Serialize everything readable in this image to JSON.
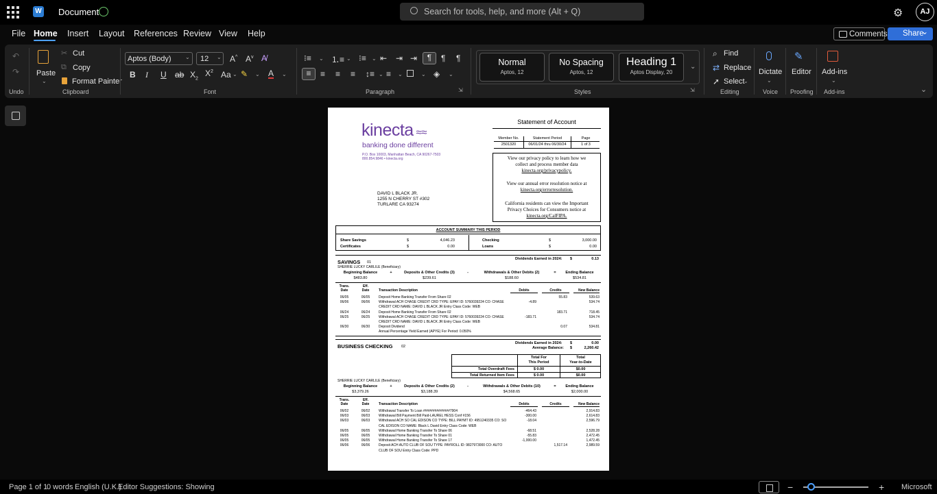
{
  "titlebar": {
    "title": "Document",
    "search_placeholder": "Search for tools, help, and more (Alt + Q)",
    "avatar": "AJ"
  },
  "menu": {
    "items": [
      "File",
      "Home",
      "Insert",
      "Layout",
      "References",
      "Review",
      "View",
      "Help"
    ],
    "comments": "Comments",
    "share": "Share"
  },
  "ribbon": {
    "clipboard": {
      "paste": "Paste",
      "cut": "Cut",
      "copy": "Copy",
      "format_painter": "Format Painter",
      "group": "Clipboard"
    },
    "undo_group": "Undo",
    "font": {
      "name": "Aptos (Body)",
      "size": "12",
      "group": "Font"
    },
    "paragraph": {
      "group": "Paragraph"
    },
    "styles": {
      "group": "Styles",
      "items": [
        {
          "name": "Normal",
          "sub": "Aptos, 12"
        },
        {
          "name": "No Spacing",
          "sub": "Aptos, 12"
        },
        {
          "name": "Heading 1",
          "sub": "Aptos Display, 20"
        }
      ]
    },
    "editing": {
      "find": "Find",
      "replace": "Replace",
      "select": "Select",
      "group": "Editing"
    },
    "voice": {
      "dictate": "Dictate",
      "group": "Voice"
    },
    "proofing": {
      "editor": "Editor",
      "group": "Proofing"
    },
    "addins": {
      "label": "Add-ins",
      "group": "Add-ins"
    }
  },
  "statusbar": {
    "page": "Page 1 of 1",
    "words": "0 words",
    "language": "English (U.K.)",
    "suggestions": "Editor Suggestions: Showing",
    "zoom_label": "Microsoft"
  },
  "doc": {
    "brand": "kinecta",
    "tagline": "banking done different",
    "address1": "P.O. Box 10003, Manhattan Beach, CA 90267-7503",
    "address2": "800.854.9846 • kinecta.org",
    "statement_title": "Statement of Account",
    "hdr": {
      "member_label": "Member No.",
      "period_label": "Statement Period",
      "page_label": "Page",
      "member": "2501320",
      "period": "06/01/24 thru 06/30/24",
      "page": "1 of 3"
    },
    "notice": [
      "View our privacy policy to learn how we",
      "collect and process member data",
      "kinecta.org/privacypolicy.",
      "View our annual error resolution notice at",
      "kinecta.org/errorresolution.",
      "California residents can view the Important",
      "Privacy Choices for Consumers notice at",
      "kinecta.org/CalFIPA."
    ],
    "recipient": [
      "DAVID L BLACK JR.",
      "1255 N CHERRY ST #302",
      "TURLARE CA 93274"
    ],
    "summary": {
      "title": "ACCOUNT SUMMARY THIS PERIOD",
      "share_savings": "Share Savings",
      "certificates": "Certificates",
      "checking": "Checking",
      "loans": "Loans",
      "dollar": "$",
      "v_ss": "4,046.23",
      "v_cert": "0.00",
      "v_chk": "3,000.00",
      "v_loans": "0.00"
    },
    "savings": {
      "title": "SAVINGS",
      "code": "01",
      "div_label": "Dividends Earned in 2024:",
      "div_val": "0.13",
      "dollar": "$",
      "beneficiary": "SHERRIE LUCKY CARLILE (Beneficiary)",
      "bal_labels": [
        "Beginning Balance",
        "+",
        "Deposits & Other Credits (3)",
        "-",
        "Withdrawals & Other Debits (2)",
        "=",
        "Ending Balance"
      ],
      "bal_values": [
        "$483.80",
        "$239.61",
        "$188.60",
        "$534.81"
      ],
      "cols": [
        "Trans.",
        "Date",
        "Eff.",
        "Date",
        "Transaction Description",
        "Debits",
        "Credits",
        "New Balance"
      ],
      "rows": [
        {
          "t": "06/05",
          "e": "06/05",
          "d": "Deposit Home Banking Transfer From Share 02",
          "db": "",
          "cr": "55.83",
          "nb": "539.63"
        },
        {
          "t": "06/06",
          "e": "06/06",
          "d": "Withdrawal ACH CHASE CREDIT CRD TYPE: EPAY ID: 5760039224 CO: CHASE",
          "db": "-4.89",
          "cr": "",
          "nb": "534.74"
        },
        {
          "t": "",
          "e": "",
          "d": "CREDIT CRD NAME: DAVID L BLACK JR Entry Class Code: WEB",
          "db": "",
          "cr": "",
          "nb": ""
        },
        {
          "t": "06/24",
          "e": "06/24",
          "d": "Deposit Home Banking Transfer From Share 02",
          "db": "",
          "cr": "183.71",
          "nb": "718.45"
        },
        {
          "t": "06/25",
          "e": "06/25",
          "d": "Withdrawal ACH CHASE CREDIT CRD TYPE: EPAY ID: 5760039224 CO: CHASE",
          "db": "-183.71",
          "cr": "",
          "nb": "534.74"
        },
        {
          "t": "",
          "e": "",
          "d": "CREDIT CRD NAME: DAVID L BLACK JR Entry Class Code: WEB",
          "db": "",
          "cr": "",
          "nb": ""
        },
        {
          "t": "06/30",
          "e": "06/30",
          "d": "Deposit Dividend",
          "db": "",
          "cr": "0.07",
          "nb": "534.81"
        },
        {
          "t": "",
          "e": "",
          "d": "Annual Percentage Yield Earned (APYE) For Period: 0.050%",
          "db": "",
          "cr": "",
          "nb": ""
        }
      ]
    },
    "checking": {
      "title": "BUSINESS CHECKING",
      "code": "02",
      "div_label": "Dividends Earned in 2024:",
      "div_val": "0.00",
      "avg_label": "Average Balance:",
      "avg_val": "2,260.42",
      "dollar": "$",
      "fees": {
        "h1a": "Total For",
        "h1b": "This Period",
        "h2a": "Total",
        "h2b": "Year-to-Date",
        "r1": "Total Overdraft Fees",
        "r1a": "$ 0.00",
        "r1b": "$0.00",
        "r2": "Total Returned Item Fees",
        "r2a": "$ 0.00",
        "r2b": "$0.00"
      },
      "beneficiary": "SHERRIE LUCKY CARLILE (Beneficiary)",
      "bal_labels": [
        "Beginning Balance",
        "+",
        "Deposits & Other Credits (2)",
        "-",
        "Withdrawals & Other Debits (10)",
        "=",
        "Ending Balance"
      ],
      "bal_values": [
        "$3,379.26",
        "$3,188.39",
        "$4,568.65",
        "$2,000.00"
      ],
      "cols": [
        "Trans.",
        "Date",
        "Eff.",
        "Date",
        "Transaction Description",
        "Debits",
        "Credits",
        "New Balance"
      ],
      "rows": [
        {
          "t": "06/02",
          "e": "06/02",
          "d": "Withdrawal Transfer To Loan ##############7904",
          "db": "-464.43",
          "cr": "",
          "nb": "2,914.83"
        },
        {
          "t": "06/03",
          "e": "06/03",
          "d": "Withdrawal Bill Payment Bill Paid-LAUREL HESS Conf #156",
          "db": "-300.00",
          "cr": "",
          "nb": "2,614.83"
        },
        {
          "t": "06/03",
          "e": "06/03",
          "d": "Withdrawal ACH SO CAL EDISON CO TYPE: BILL PAYMT ID: 4951240335 CO: SO",
          "db": "-18.04",
          "cr": "",
          "nb": "2,596.79"
        },
        {
          "t": "",
          "e": "",
          "d": "CAL EDISON CO NAME: Black L David Entry Class Code: WEB",
          "db": "",
          "cr": "",
          "nb": ""
        },
        {
          "t": "06/05",
          "e": "06/05",
          "d": "Withdrawal Home Banking Transfer To Share 06",
          "db": "-68.51",
          "cr": "",
          "nb": "2,528.28"
        },
        {
          "t": "06/05",
          "e": "06/05",
          "d": "Withdrawal Home Banking Transfer To Share 01",
          "db": "-55.83",
          "cr": "",
          "nb": "2,472.45"
        },
        {
          "t": "06/05",
          "e": "06/05",
          "d": "Withdrawal Home Banking Transfer To Share 17",
          "db": "-1,000.00",
          "cr": "",
          "nb": "1,472.45"
        },
        {
          "t": "06/06",
          "e": "06/06",
          "d": "Deposit ACH AUTO CLUB OF SOU TYPE: PAYROLL ID: 9827973000 CO: AUTO",
          "db": "",
          "cr": "1,517.14",
          "nb": "2,989.59"
        },
        {
          "t": "",
          "e": "",
          "d": "CLUB OF SOU Entry Class Code: PPD",
          "db": "",
          "cr": "",
          "nb": ""
        }
      ]
    }
  }
}
